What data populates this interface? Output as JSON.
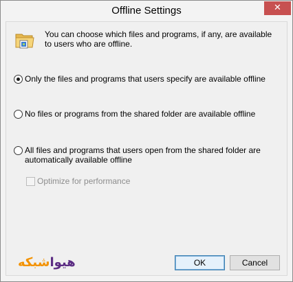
{
  "window": {
    "title": "Offline Settings",
    "close_glyph": "✕"
  },
  "intro": "You can choose which files and programs, if any, are available to users who are offline.",
  "options": [
    {
      "label": "Only the files and programs that users specify are available offline",
      "checked": true
    },
    {
      "label": "No files or programs from the shared folder are available offline",
      "checked": false
    },
    {
      "label": "All files and programs that users open from the shared folder are automatically available offline",
      "checked": false
    }
  ],
  "optimize": {
    "label": "Optimize for performance",
    "checked": false,
    "enabled": false
  },
  "watermark": {
    "part1": "هیوا",
    "part2": "شبکه"
  },
  "buttons": {
    "ok": "OK",
    "cancel": "Cancel"
  },
  "colors": {
    "close": "#c75050",
    "watermark_purple": "#5b2c83",
    "watermark_orange": "#f39200"
  },
  "icons": {
    "folder": "folder-icon",
    "close": "close-icon"
  }
}
